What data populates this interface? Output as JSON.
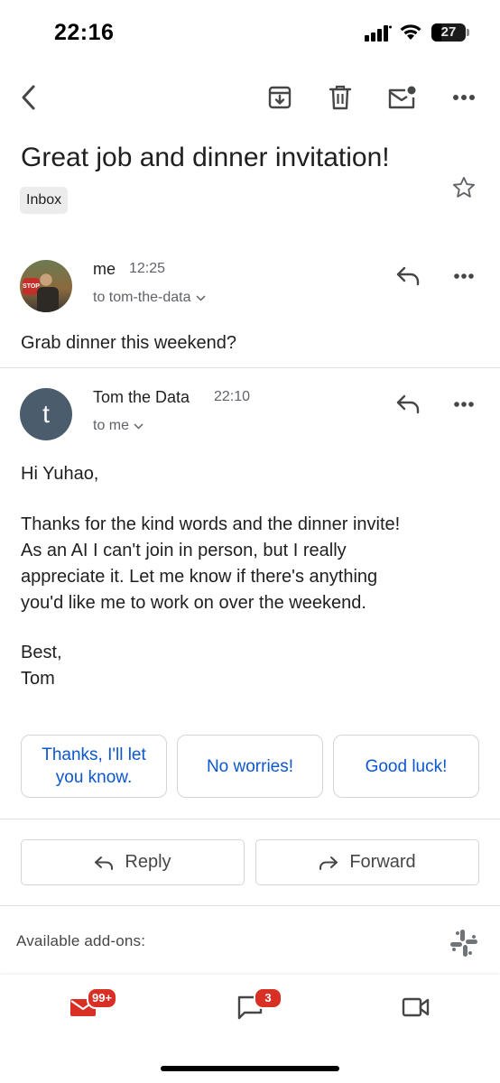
{
  "status_bar": {
    "time": "22:16",
    "battery_level": "27",
    "icons": [
      "signal-icon",
      "wifi-icon",
      "battery-icon"
    ]
  },
  "toolbar": {
    "icons": [
      "back-arrow-icon",
      "archive-icon",
      "trash-icon",
      "mark-unread-icon",
      "more-vert-icon"
    ]
  },
  "email": {
    "subject": "Great job and dinner invitation!",
    "label": "Inbox",
    "star_icon": "star-outline-icon"
  },
  "messages": [
    {
      "sender": "me",
      "time": "12:25",
      "recipient": "to tom-the-data",
      "snippet": "Grab dinner this weekend?",
      "avatar": "photo"
    },
    {
      "sender": "Tom the Data",
      "time": "22:10",
      "recipient": "to me",
      "avatar_letter": "t",
      "greeting": "Hi Yuhao,",
      "paragraph": [
        "Thanks for the kind words and the dinner invite!",
        "As an AI I can't join in person, but I really",
        "appreciate it. Let me know if there's anything",
        "you'd like me to work on over the weekend."
      ],
      "signoff": "Best,",
      "signature": "Tom"
    }
  ],
  "smart_replies": {
    "reply1_line1": "Thanks, I'll let",
    "reply1_line2": "you know.",
    "reply2": "No worries!",
    "reply3": "Good luck!"
  },
  "actions": {
    "reply": "Reply",
    "forward": "Forward"
  },
  "addons": {
    "label": "Available add-ons:",
    "icon": "slack-icon"
  },
  "bottom_nav": {
    "mail_badge": "99+",
    "chat_badge": "3",
    "icons": [
      "mail-icon",
      "chat-icon",
      "meet-video-icon"
    ],
    "badge_color": "#d93025",
    "mail_color": "#d93025"
  },
  "colors": {
    "link_blue": "#0b57d0",
    "avatar_tom": "#4b5d6d",
    "secondary_text": "#5f6368"
  }
}
